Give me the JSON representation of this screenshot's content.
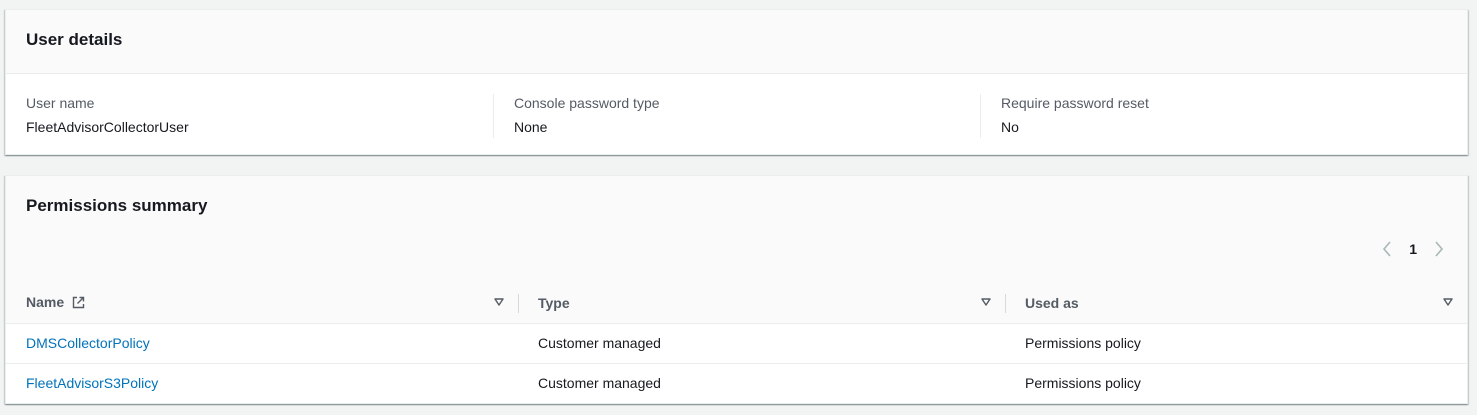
{
  "user_details": {
    "title": "User details",
    "fields": [
      {
        "label": "User name",
        "value": "FleetAdvisorCollectorUser"
      },
      {
        "label": "Console password type",
        "value": "None"
      },
      {
        "label": "Require password reset",
        "value": "No"
      }
    ]
  },
  "permissions": {
    "title": "Permissions summary",
    "pagination": {
      "current_page": "1"
    },
    "columns": [
      "Name",
      "Type",
      "Used as"
    ],
    "rows": [
      {
        "name": "DMSCollectorPolicy",
        "type": "Customer managed",
        "used_as": "Permissions policy"
      },
      {
        "name": "FleetAdvisorS3Policy",
        "type": "Customer managed",
        "used_as": "Permissions policy"
      }
    ]
  },
  "colors": {
    "link": "#0073bb",
    "background": "#f2f3f3",
    "header_bg": "#fafafa"
  },
  "icons": [
    "external-link-icon",
    "sort-icon",
    "chevron-left-icon",
    "chevron-right-icon"
  ]
}
